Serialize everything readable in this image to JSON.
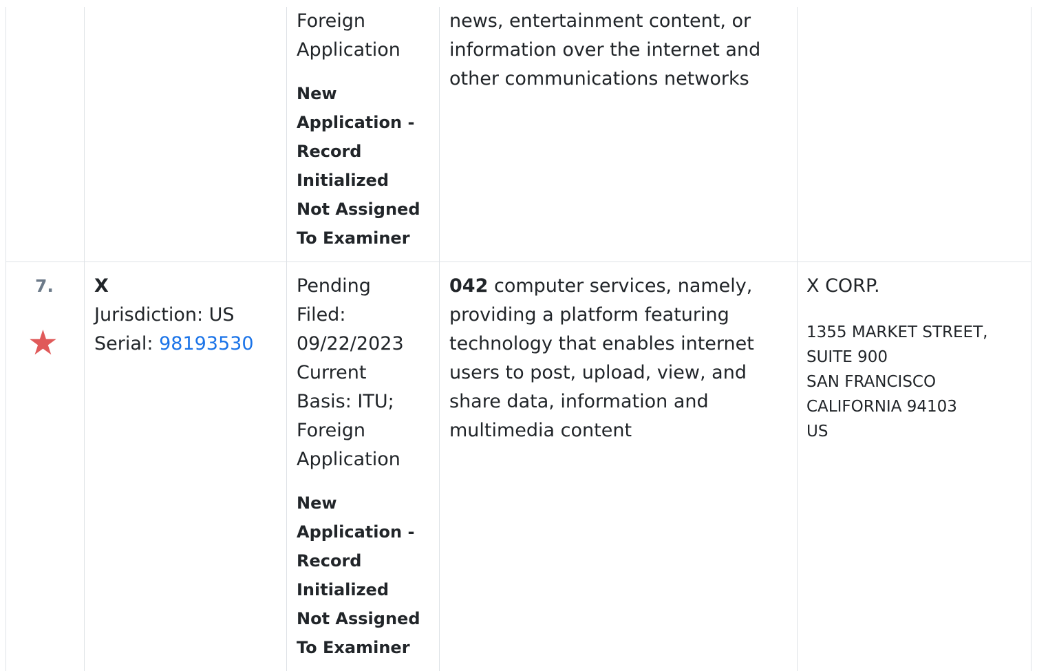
{
  "prev_row": {
    "status_lines": [
      "Foreign",
      "Application"
    ],
    "status_note_lines": [
      "New",
      "Application -",
      "Record",
      "Initialized",
      "Not Assigned",
      "To Examiner"
    ],
    "goods_lines": [
      "news, entertainment content, or",
      "information over the internet and",
      "other communications networks"
    ]
  },
  "row7": {
    "number": "7.",
    "star_icon": "star-icon",
    "star_color": "#e05a5a",
    "mark_name": "X",
    "jurisdiction": "Jurisdiction: US",
    "serial_label": "Serial:",
    "serial_number": "98193530",
    "status_lines": [
      "Pending",
      "Filed:",
      "09/22/2023",
      "Current",
      "Basis: ITU;",
      "Foreign",
      "Application"
    ],
    "status_note_lines": [
      "New",
      "Application -",
      "Record",
      "Initialized",
      "Not Assigned",
      "To Examiner"
    ],
    "class_code": "042",
    "goods_lines": [
      "computer services, namely,",
      "providing a platform featuring",
      "technology that enables internet",
      "users to post, upload, view, and",
      "share data, information and",
      "multimedia content"
    ],
    "owner_name": "X CORP.",
    "address_lines": [
      "1355 MARKET STREET,",
      "SUITE 900",
      "SAN FRANCISCO",
      "CALIFORNIA 94103",
      "US"
    ]
  }
}
